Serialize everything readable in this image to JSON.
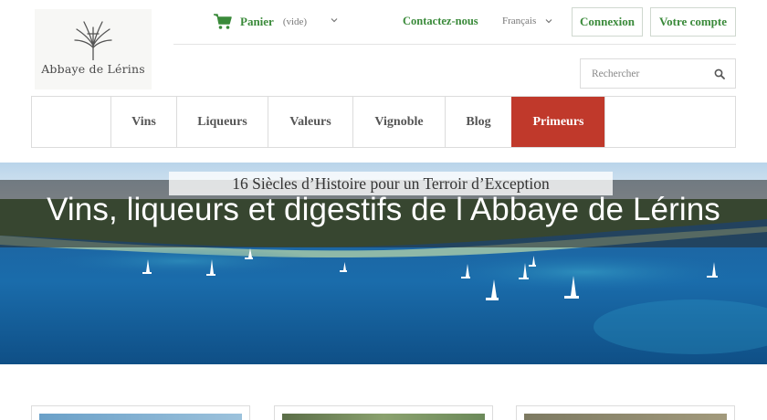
{
  "logo": {
    "text": "Abbaye de Lérins",
    "icon": "palm-cross-icon"
  },
  "cart": {
    "label": "Panier",
    "status": "(vide)",
    "icon": "cart-icon"
  },
  "header": {
    "contact_label": "Contactez-nous",
    "language": "Français",
    "login_label": "Connexion",
    "account_label": "Votre compte"
  },
  "search": {
    "placeholder": "Rechercher",
    "icon": "search-icon"
  },
  "nav": {
    "items": [
      {
        "label": ""
      },
      {
        "label": "Vins"
      },
      {
        "label": "Liqueurs"
      },
      {
        "label": "Valeurs"
      },
      {
        "label": "Vignoble"
      },
      {
        "label": "Blog"
      },
      {
        "label": "Primeurs"
      }
    ],
    "active_color": "#c0392b"
  },
  "hero": {
    "subtitle": "16 Siècles d’Histoire pour un Terroir d’Exception",
    "title": "Vins, liqueurs et digestifs de l Abbaye de Lérins"
  },
  "colors": {
    "accent_green": "#3a8a3a",
    "accent_red": "#c0392b"
  }
}
